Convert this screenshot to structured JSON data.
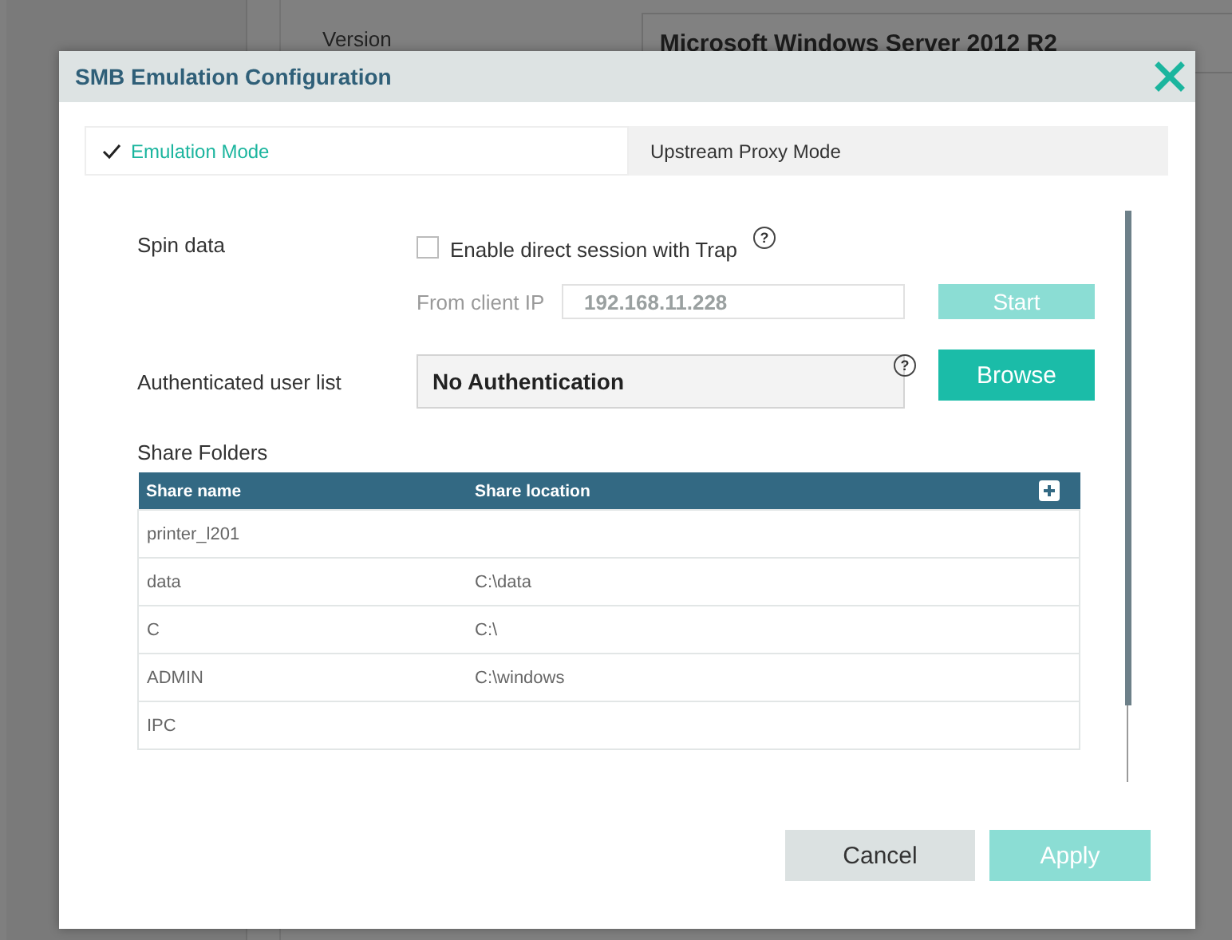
{
  "background": {
    "version_label": "Version",
    "version_value": "Microsoft Windows Server 2012 R2"
  },
  "dialog": {
    "title": "SMB Emulation Configuration",
    "tabs": [
      {
        "label": "Emulation Mode",
        "selected": true
      },
      {
        "label": "Upstream Proxy Mode",
        "selected": false
      }
    ],
    "spin_data": {
      "label": "Spin data",
      "checkbox": {
        "label": "Enable direct session with Trap",
        "checked": false
      },
      "help": "?",
      "client_ip": {
        "label": "From client IP",
        "value": "192.168.11.228",
        "disabled": true
      },
      "start_button": {
        "label": "Start",
        "disabled": true
      }
    },
    "auth": {
      "label": "Authenticated user list",
      "value": "No Authentication",
      "help": "?",
      "browse_button": {
        "label": "Browse",
        "disabled": false
      }
    },
    "share_folders": {
      "label": "Share Folders",
      "columns": [
        "Share name",
        "Share location"
      ],
      "rows": [
        [
          "printer_l201",
          ""
        ],
        [
          "data",
          "C:\\data"
        ],
        [
          "C",
          "C:\\"
        ],
        [
          "ADMIN",
          "C:\\windows"
        ],
        [
          "IPC",
          ""
        ]
      ]
    },
    "buttons": [
      {
        "label": "Cancel",
        "kind": "secondary",
        "disabled": false
      },
      {
        "label": "Apply",
        "kind": "primary",
        "disabled": true
      }
    ]
  }
}
